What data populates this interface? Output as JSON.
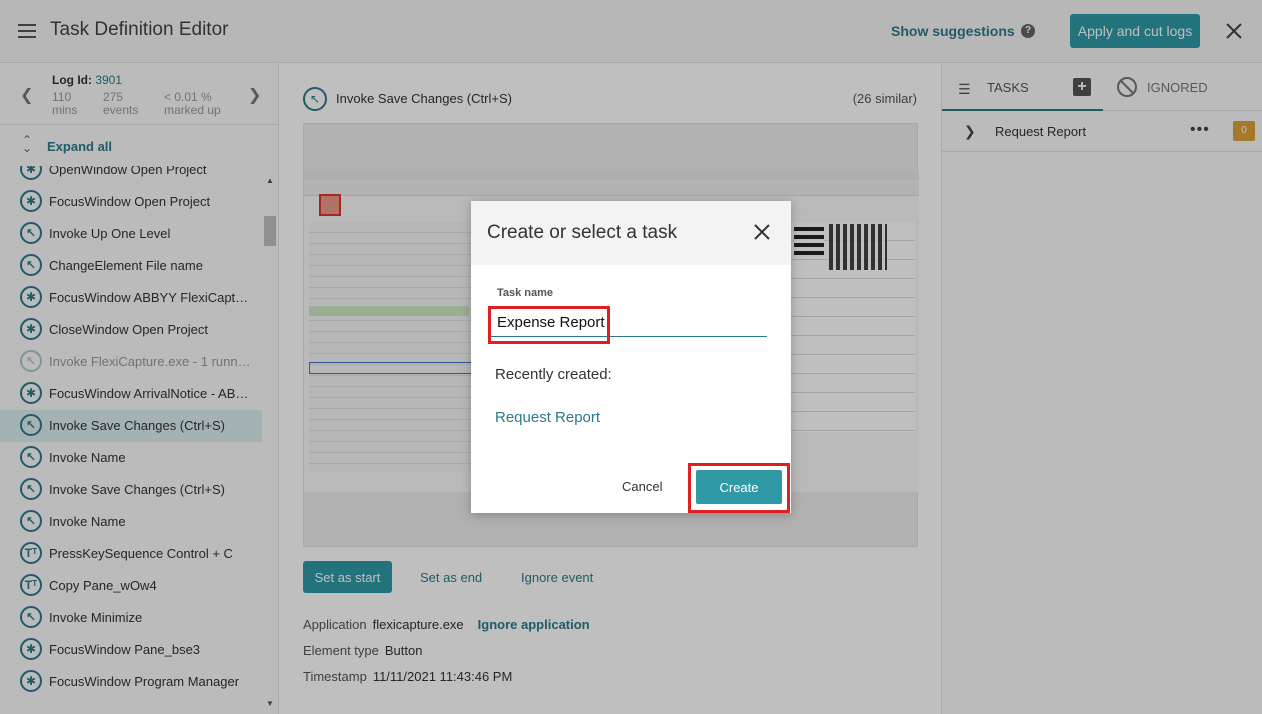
{
  "header": {
    "title": "Task Definition Editor",
    "show_suggestions": "Show suggestions",
    "apply_button": "Apply and cut logs"
  },
  "sidebar": {
    "log_label": "Log Id:",
    "log_id": "3901",
    "stats": [
      {
        "value": "110",
        "unit": "mins"
      },
      {
        "value": "275",
        "unit": "events"
      },
      {
        "value": "< 0.01 %",
        "unit": "marked up"
      }
    ],
    "expand_all": "Expand all",
    "items": [
      {
        "icon": "asterisk-icon",
        "label": "OpenWindow Open Project",
        "selected": false,
        "dim": false
      },
      {
        "icon": "asterisk-icon",
        "label": "FocusWindow Open Project",
        "selected": false,
        "dim": false
      },
      {
        "icon": "cursor-icon",
        "label": "Invoke Up One Level",
        "selected": false,
        "dim": false
      },
      {
        "icon": "cursor-icon",
        "label": "ChangeElement File name",
        "selected": false,
        "dim": false
      },
      {
        "icon": "asterisk-icon",
        "label": "FocusWindow ABBYY FlexiCaptu…",
        "selected": false,
        "dim": false
      },
      {
        "icon": "asterisk-icon",
        "label": "CloseWindow Open Project",
        "selected": false,
        "dim": false
      },
      {
        "icon": "cursor-icon",
        "label": "Invoke FlexiCapture.exe - 1 runn…",
        "selected": false,
        "dim": true
      },
      {
        "icon": "asterisk-icon",
        "label": "FocusWindow ArrivalNotice - AB…",
        "selected": false,
        "dim": false
      },
      {
        "icon": "cursor-icon",
        "label": "Invoke Save Changes (Ctrl+S)",
        "selected": true,
        "dim": false
      },
      {
        "icon": "cursor-icon",
        "label": "Invoke Name",
        "selected": false,
        "dim": false
      },
      {
        "icon": "cursor-icon",
        "label": "Invoke Save Changes (Ctrl+S)",
        "selected": false,
        "dim": false
      },
      {
        "icon": "cursor-icon",
        "label": "Invoke Name",
        "selected": false,
        "dim": false
      },
      {
        "icon": "text-icon",
        "label": "PressKeySequence Control + C",
        "selected": false,
        "dim": false
      },
      {
        "icon": "text-icon",
        "label": "Copy Pane_wOw4",
        "selected": false,
        "dim": false
      },
      {
        "icon": "cursor-icon",
        "label": "Invoke Minimize",
        "selected": false,
        "dim": false
      },
      {
        "icon": "asterisk-icon",
        "label": "FocusWindow Pane_bse3",
        "selected": false,
        "dim": false
      },
      {
        "icon": "asterisk-icon",
        "label": "FocusWindow Program Manager",
        "selected": false,
        "dim": false
      }
    ]
  },
  "event": {
    "title": "Invoke Save Changes (Ctrl+S)",
    "similar": "(26 similar)",
    "set_start": "Set as start",
    "set_end": "Set as end",
    "ignore_event": "Ignore event",
    "application_label": "Application",
    "application_value": "flexicapture.exe",
    "ignore_application": "Ignore application",
    "element_type_label": "Element type",
    "element_type_value": "Button",
    "timestamp_label": "Timestamp",
    "timestamp_value": "11/11/2021 11:43:46 PM"
  },
  "right_panel": {
    "tasks_tab": "TASKS",
    "ignored_tab": "IGNORED",
    "tasks": [
      {
        "name": "Request Report",
        "count": "0"
      }
    ]
  },
  "modal": {
    "title": "Create or select a task",
    "field_label": "Task name",
    "field_value": "Expense Report",
    "recently_created": "Recently created:",
    "recent_items": [
      "Request Report"
    ],
    "cancel": "Cancel",
    "create": "Create"
  },
  "colors": {
    "accent": "#2f9aa6",
    "link": "#2b7a8a",
    "highlight": "#e02020",
    "badge": "#e0a238"
  }
}
